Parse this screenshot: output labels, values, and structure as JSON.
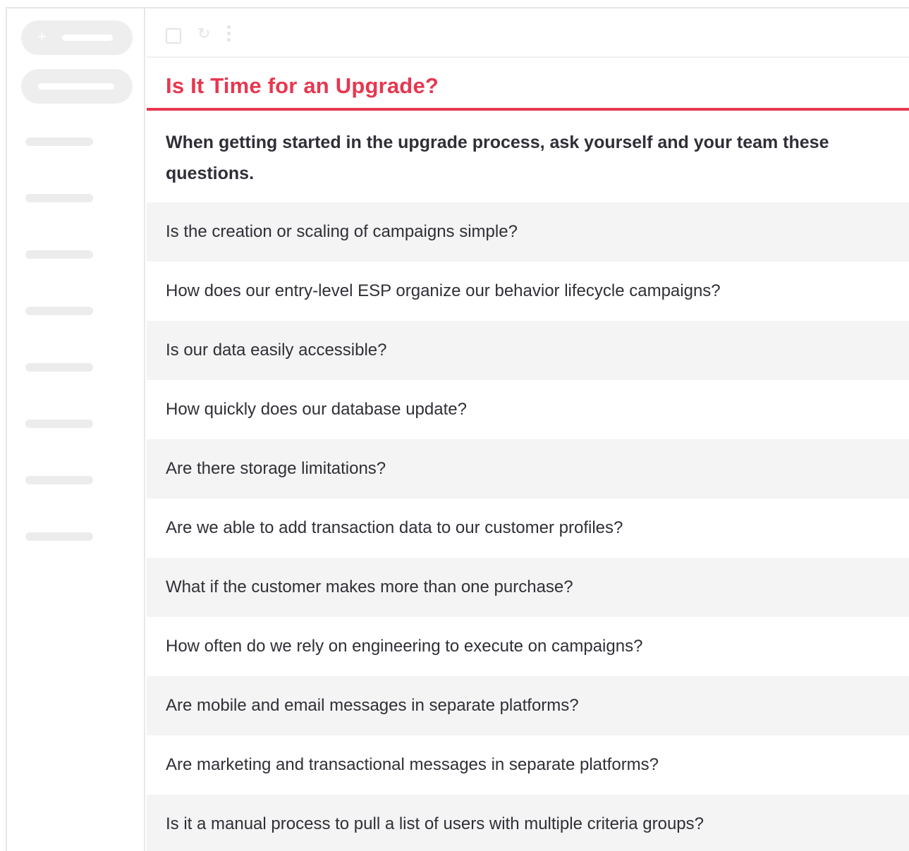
{
  "sidebar": {
    "compose_icon": "+",
    "nav_item_count": 8
  },
  "toolbar": {
    "refresh_icon": "↻"
  },
  "content": {
    "title": "Is It Time for an Upgrade?",
    "intro": "When getting started in the upgrade process, ask yourself and your team these questions.",
    "questions": [
      "Is the creation or scaling of campaigns simple?",
      "How does our entry-level ESP organize our behavior lifecycle campaigns?",
      "Is our data easily accessible?",
      "How quickly does our database update?",
      "Are there storage limitations?",
      "Are we able to add transaction data to our customer profiles?",
      "What if the customer makes more than one purchase?",
      "How often do we rely on engineering to execute on campaigns?",
      "Are mobile and email messages in separate platforms?",
      "Are marketing and transactional messages in separate platforms?",
      "Is it a manual process to pull a list of users with multiple criteria groups?"
    ]
  },
  "colors": {
    "accent": "#e8374f",
    "text": "#2f2f37",
    "row_alt": "#f4f4f4",
    "placeholder": "#eeeeee"
  }
}
